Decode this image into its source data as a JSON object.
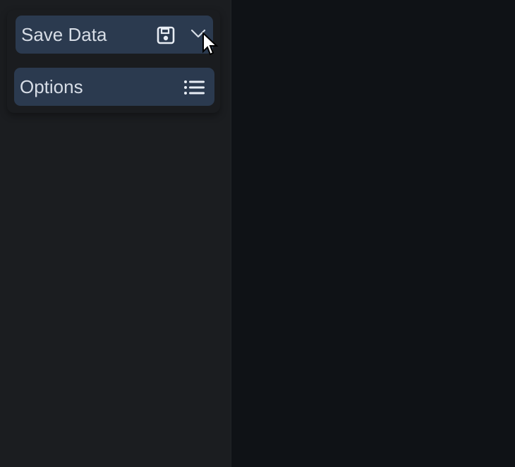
{
  "menu": {
    "items": [
      {
        "label": "Save Data",
        "icon": "save-icon",
        "trailing_icon": "chevron-down-icon"
      },
      {
        "label": "Options",
        "icon": "list-icon"
      }
    ]
  },
  "colors": {
    "background": "#0f1216",
    "sidebar": "#1b1d20",
    "menu_item": "#2b3a4f",
    "text": "#d7dde6"
  }
}
